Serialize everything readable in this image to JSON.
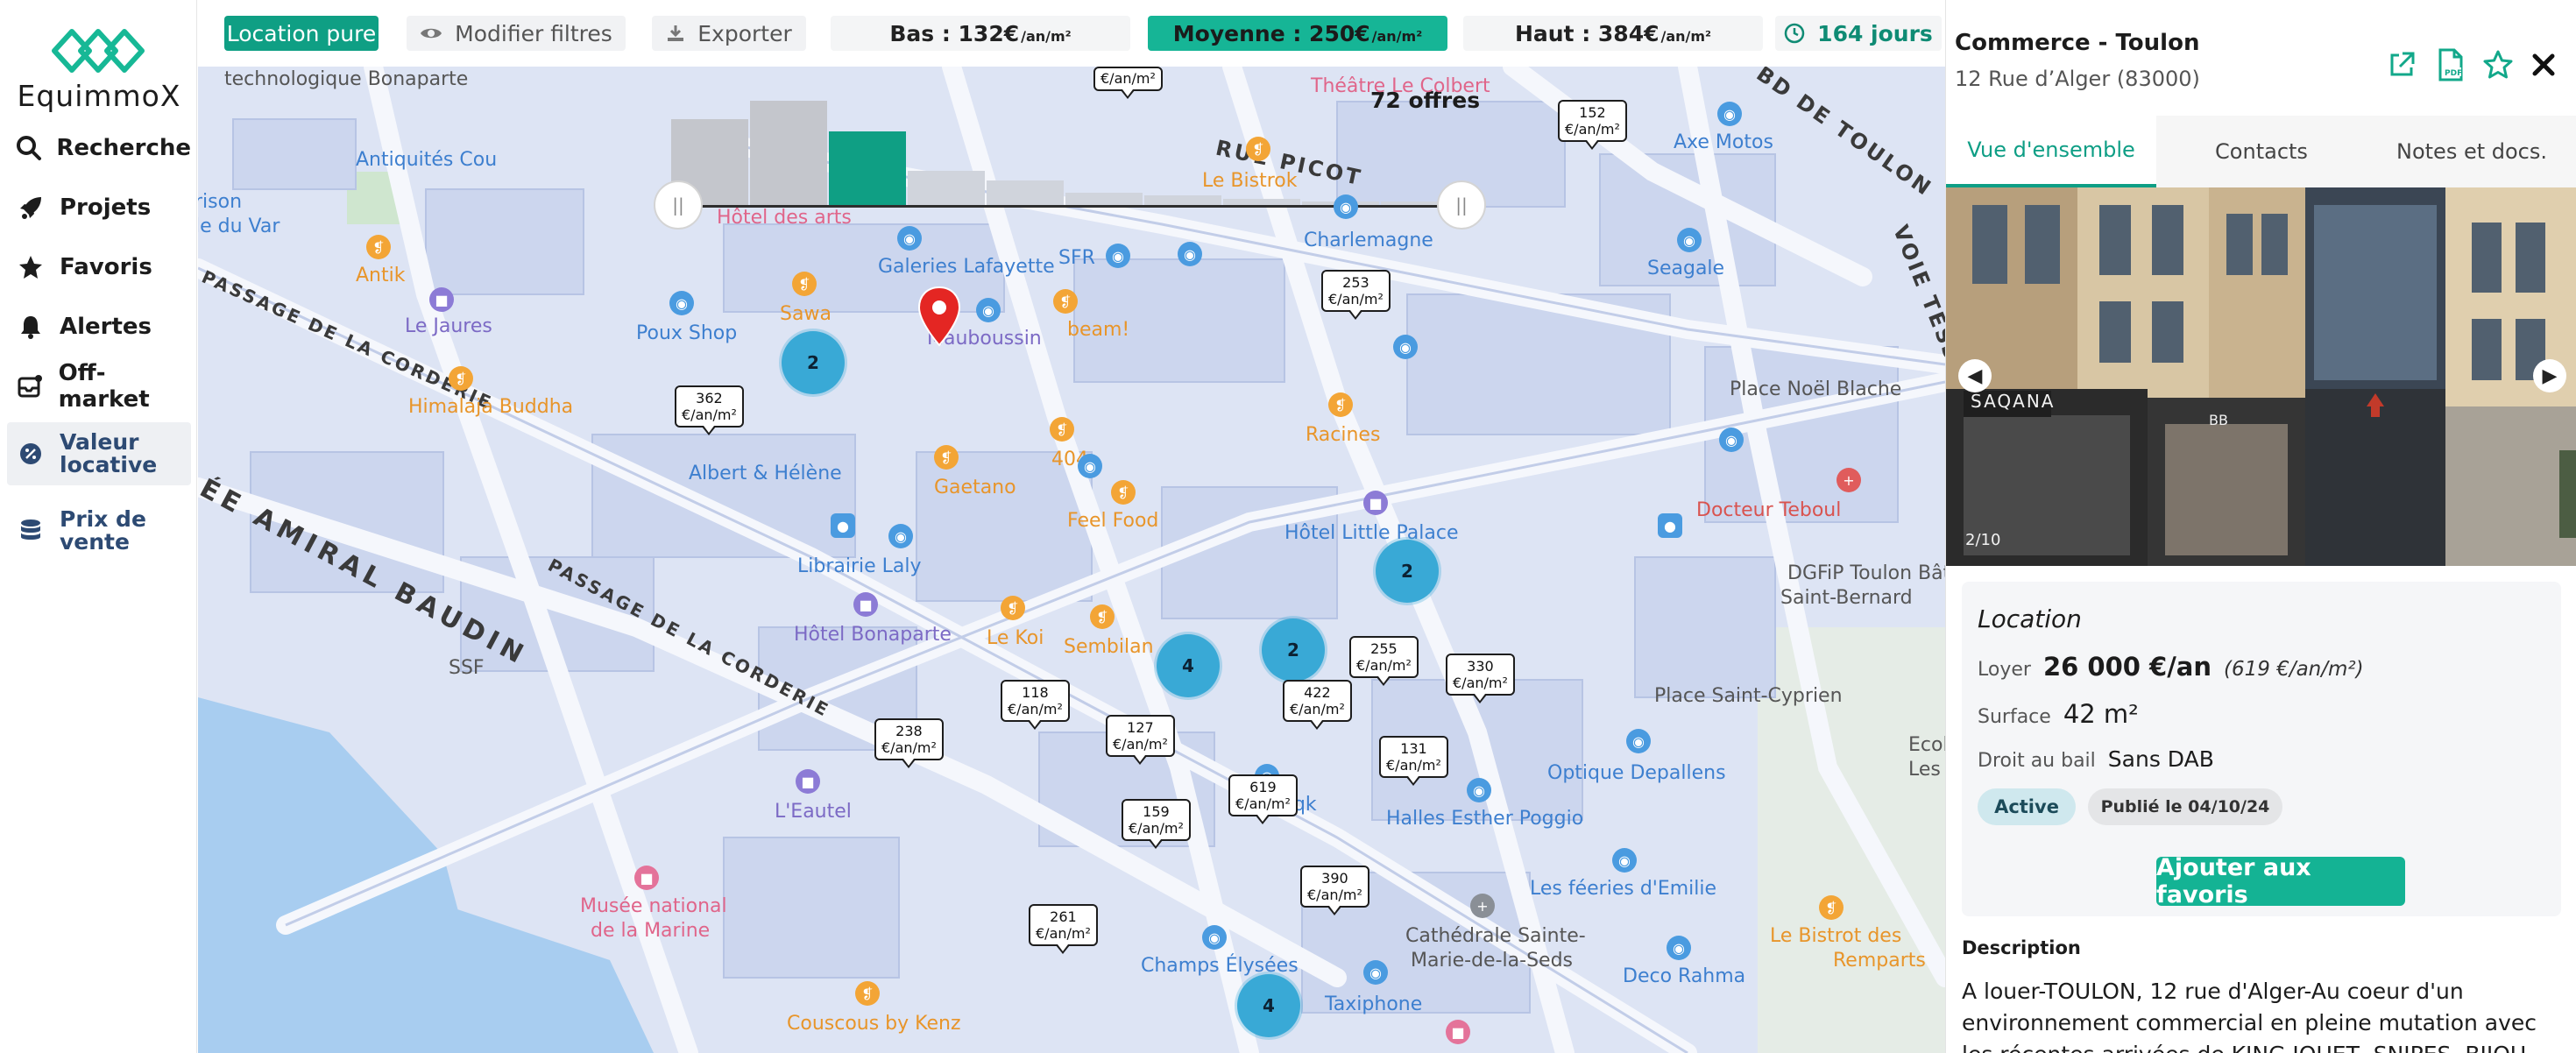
{
  "app": {
    "brand": "EquimmoX",
    "accent_color": "#0f9f84"
  },
  "sidebar": {
    "items": [
      {
        "label": "Recherche",
        "icon": "search-icon"
      },
      {
        "label": "Projets",
        "icon": "rocket-icon"
      },
      {
        "label": "Favoris",
        "icon": "star-icon"
      },
      {
        "label": "Alertes",
        "icon": "bell-icon"
      },
      {
        "label": "Off-market",
        "icon": "inbox-icon"
      },
      {
        "label": "Valeur locative",
        "icon": "percent-badge-icon",
        "active": true
      },
      {
        "label": "Prix de vente",
        "icon": "coins-icon"
      }
    ]
  },
  "toolbar": {
    "location_label": "Location pure",
    "filters_label": "Modifier filtres",
    "export_label": "Exporter",
    "low_label": "Bas : 132€",
    "low_unit": "/an/m²",
    "mid_label": "Moyenne : 250€",
    "mid_unit": "/an/m²",
    "high_label": "Haut : 384€",
    "high_unit": "/an/m²",
    "days_label": "164 jours"
  },
  "map": {
    "offers_count": "72 offres",
    "histogram_values": [
      0.7,
      0.85,
      0.6,
      0.28,
      0.2,
      0.1,
      0.08,
      0.05,
      0.03,
      0.03
    ],
    "histogram_highlight_index": 2,
    "streets": [
      "RUE PICOT",
      "BD DE TOULON",
      "VOIE TESSE-",
      "PASSAGE DE LA CORDERIE",
      "ÉE AMIRAL BAUDIN",
      "PASSAGE DE LA CORDERIE"
    ],
    "places": [
      "technologique Bonaparte",
      "Antiquités Cou",
      "rison",
      "le du Var",
      "Antik",
      "Le Jaures",
      "Poux Shop",
      "Himalaja Buddha",
      "Sawa",
      "Galeries Lafayette",
      "SFR",
      "Mauboussin",
      "beam!",
      "Hôtel des arts",
      "Le Bistrok",
      "Théâtre Le Colbert",
      "Charlemagne",
      "Axe Motos",
      "Seagale",
      "Place Noël Blache",
      "Racines",
      "Albert & Hélène",
      "Gaetano",
      "404",
      "Feel Food",
      "Docteur Teboul",
      "Librairie Laly",
      "Hôtel Little Palace",
      "DGFiP Toulon Bâti",
      "Saint-Bernard",
      "Hôtel Bonaparte",
      "Le Koi",
      "Sembilan",
      "SSF",
      "Place Saint-Cyprien",
      "Optique Depallens",
      "Jaqk",
      "Halles Esther Poggio",
      "L'Eautel",
      "Ecol",
      "Les",
      "Les féeries d'Emilie",
      "Cathédrale Sainte-",
      "Marie-de-la-Seds",
      "Musée national",
      "de la Marine",
      "Champs Élysées",
      "Le Bistrot des",
      "Remparts",
      "Deco Rahma",
      "Taxiphone",
      "Couscous by Kenz"
    ],
    "price_markers": [
      {
        "value": "152",
        "unit": "€/an/m²"
      },
      {
        "value": "253",
        "unit": "€/an/m²"
      },
      {
        "value": "362",
        "unit": "€/an/m²"
      },
      {
        "value": "255",
        "unit": "€/an/m²"
      },
      {
        "value": "330",
        "unit": "€/an/m²"
      },
      {
        "value": "422",
        "unit": "€/an/m²"
      },
      {
        "value": "118",
        "unit": "€/an/m²"
      },
      {
        "value": "238",
        "unit": "€/an/m²"
      },
      {
        "value": "127",
        "unit": "€/an/m²"
      },
      {
        "value": "131",
        "unit": "€/an/m²"
      },
      {
        "value": "619",
        "unit": "€/an/m²"
      },
      {
        "value": "159",
        "unit": "€/an/m²"
      },
      {
        "value": "390",
        "unit": "€/an/m²"
      },
      {
        "value": "261",
        "unit": "€/an/m²"
      },
      {
        "value": "",
        "unit": "€/an/m²"
      }
    ],
    "clusters": [
      "2",
      "2",
      "2",
      "4",
      "4"
    ]
  },
  "detail": {
    "title": "Commerce - Toulon",
    "address": "12 Rue d’Alger (83000)",
    "tabs": [
      "Vue d'ensemble",
      "Contacts",
      "Notes et docs."
    ],
    "active_tab": 0,
    "photo_signs": [
      "SAQANA",
      "BB",
      "2/10"
    ],
    "section_title": "Location",
    "rent_label": "Loyer",
    "rent_value": "26 000 €/an",
    "rent_per_m2": "(619 €/an/m²)",
    "surface_label": "Surface",
    "surface_value": "42 m²",
    "lease_label": "Droit au bail",
    "lease_value": "Sans DAB",
    "status_badge": "Active",
    "published_badge": "Publié le 04/10/24",
    "favorite_button": "Ajouter aux favoris",
    "description_title": "Description",
    "description_text": "A louer-TOULON, 12 rue d'Alger-Au coeur d'un environnement commercial en pleine mutation avec les récentes arrivées de KING JOUET, SNIPES, BIJOU"
  }
}
